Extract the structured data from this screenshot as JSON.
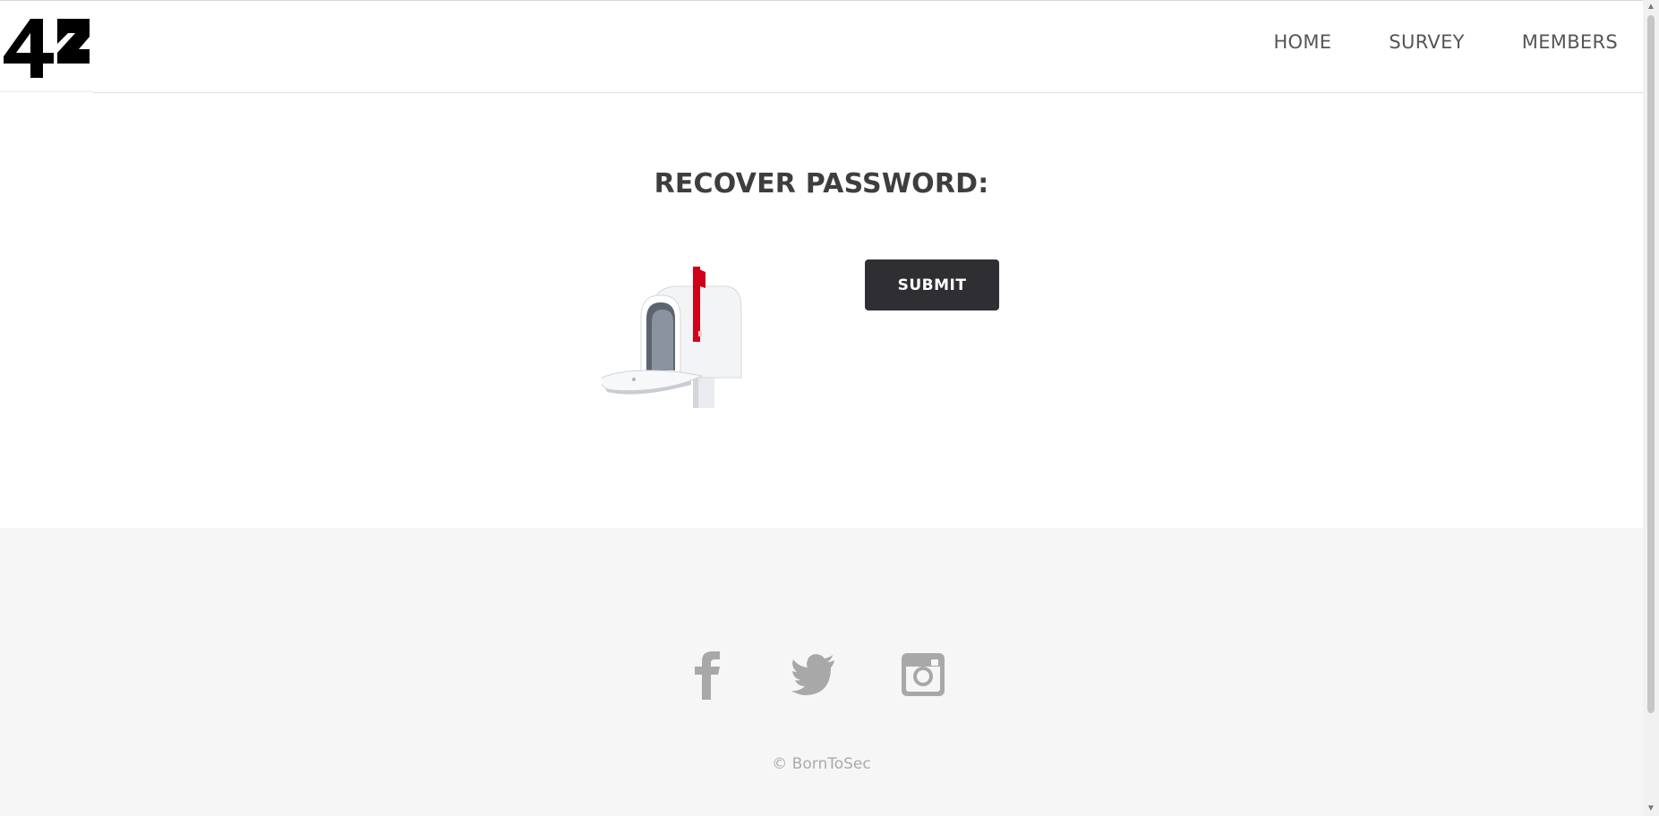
{
  "header": {
    "logo_text": "42",
    "nav": [
      {
        "label": "HOME"
      },
      {
        "label": "SURVEY"
      },
      {
        "label": "MEMBERS"
      }
    ]
  },
  "main": {
    "title": "RECOVER PASSWORD:",
    "submit_label": "SUBMIT"
  },
  "footer": {
    "social_icons": [
      "facebook-icon",
      "twitter-icon",
      "instagram-icon"
    ],
    "copyright": "© BornToSec"
  },
  "colors": {
    "button_bg": "#2f2f33",
    "footer_bg": "#f6f6f6",
    "icon_gray": "#a8a8a8",
    "mailbox_flag": "#d0021b"
  }
}
